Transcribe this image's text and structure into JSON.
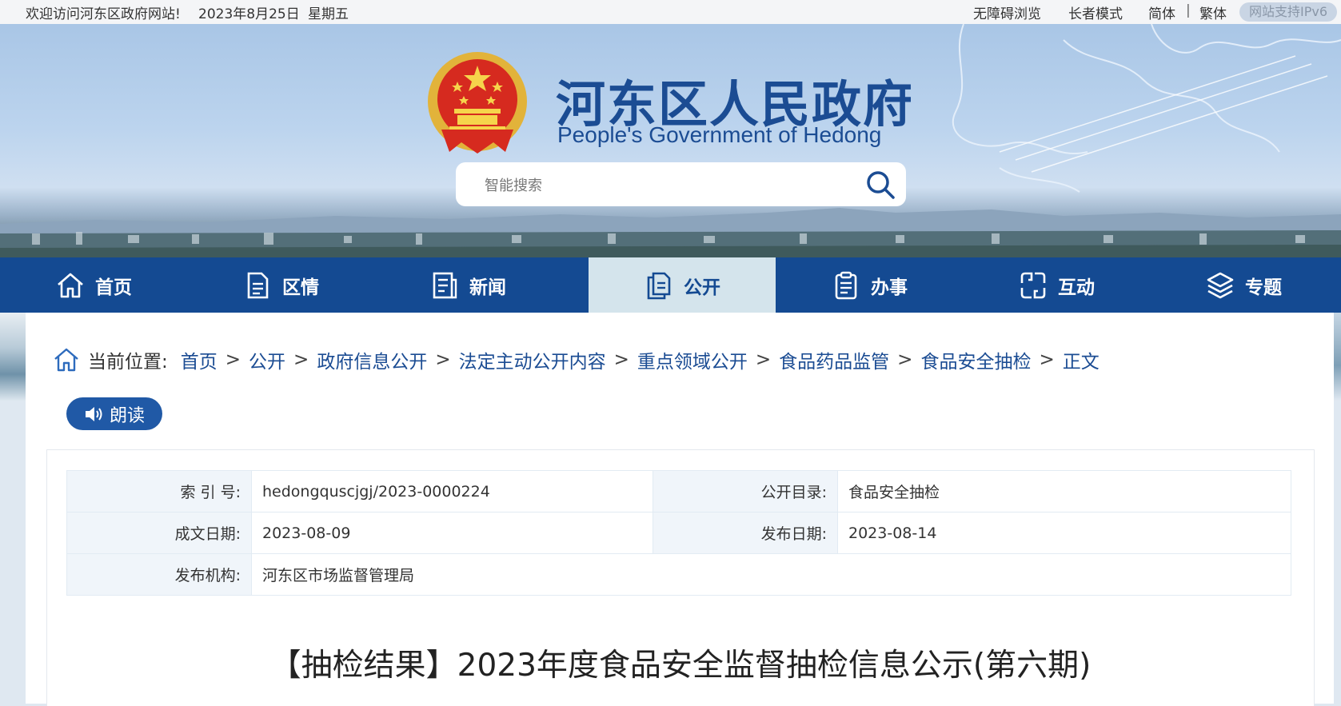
{
  "topbar": {
    "welcome": "欢迎访问河东区政府网站!",
    "date": "2023年8月25日",
    "weekday": "星期五",
    "accessibility": "无障碍浏览",
    "elder_mode": "长者模式",
    "simplified": "简体",
    "separator": "|",
    "traditional": "繁体",
    "ipv6": "网站支持IPv6"
  },
  "header": {
    "site_title": "河东区人民政府",
    "site_subtitle": "People's Government of Hedong",
    "search_placeholder": "智能搜索"
  },
  "nav": {
    "items": [
      {
        "label": "首页",
        "icon": "home-icon"
      },
      {
        "label": "区情",
        "icon": "document-icon"
      },
      {
        "label": "新闻",
        "icon": "news-icon"
      },
      {
        "label": "公开",
        "icon": "files-icon",
        "active": true
      },
      {
        "label": "办事",
        "icon": "clipboard-icon"
      },
      {
        "label": "互动",
        "icon": "interaction-icon"
      },
      {
        "label": "专题",
        "icon": "layers-icon"
      }
    ]
  },
  "breadcrumb": {
    "label": "当前位置:",
    "items": [
      "首页",
      "公开",
      "政府信息公开",
      "法定主动公开内容",
      "重点领域公开",
      "食品药品监管",
      "食品安全抽检",
      "正文"
    ],
    "separator": ">"
  },
  "read_button": "朗读",
  "meta": {
    "index_label": "索 引 号:",
    "index_value": "hedongquscjgj/2023-0000224",
    "catalog_label": "公开目录:",
    "catalog_value": "食品安全抽检",
    "created_label": "成文日期:",
    "created_value": "2023-08-09",
    "published_label": "发布日期:",
    "published_value": "2023-08-14",
    "agency_label": "发布机构:",
    "agency_value": "河东区市场监督管理局"
  },
  "article": {
    "title": "【抽检结果】2023年度食品安全监督抽检信息公示(第六期)"
  },
  "colors": {
    "nav_bg": "#144a92",
    "nav_active_bg": "#d4e4ec",
    "title_blue": "#1b4c93",
    "read_button_bg": "#2059a6"
  }
}
